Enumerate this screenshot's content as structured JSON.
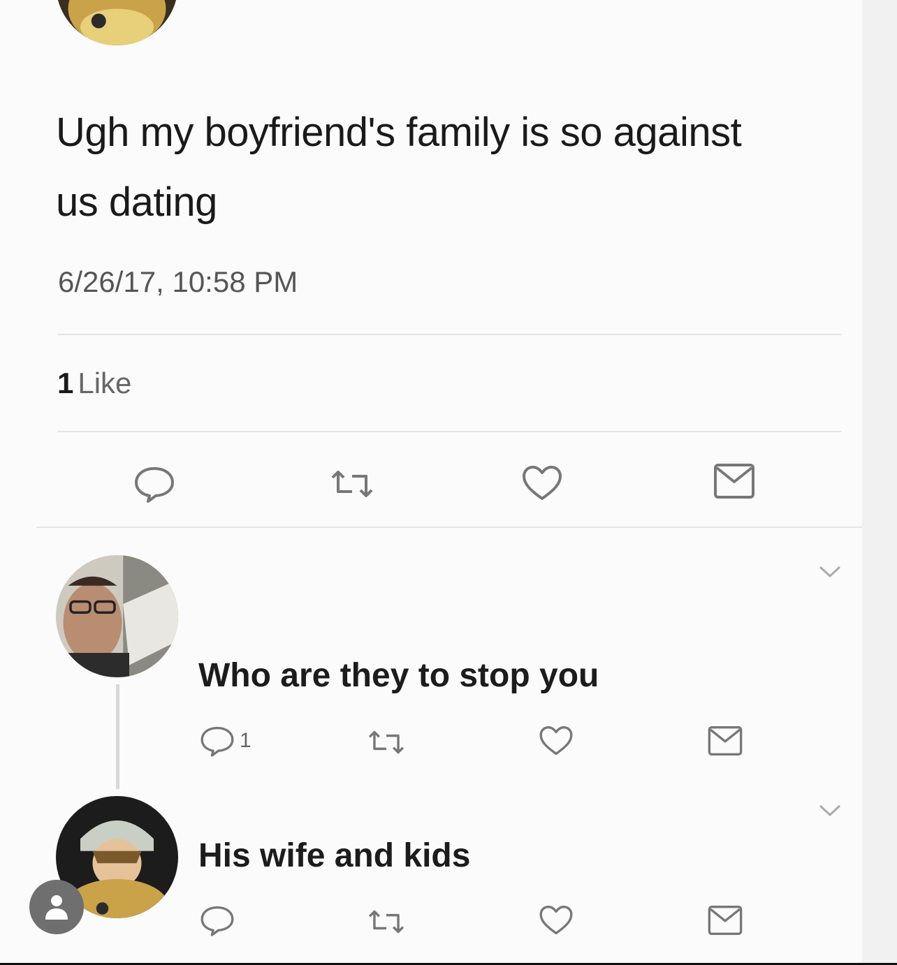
{
  "tweet": {
    "text": "Ugh my boyfriend's family is so against us dating",
    "timestamp": "6/26/17, 10:58 PM",
    "likes_count": "1",
    "likes_label": "Like"
  },
  "replies": [
    {
      "text": "Who are they to stop you",
      "reply_count": "1"
    },
    {
      "text": "His wife and kids",
      "reply_count": ""
    }
  ],
  "icons": {
    "reply": "reply-icon",
    "retweet": "retweet-icon",
    "like": "heart-icon",
    "dm": "mail-icon",
    "more": "chevron-down-icon",
    "profile": "person-icon"
  },
  "colors": {
    "icon_gray": "#777777",
    "fab": "#6f6f6f"
  }
}
